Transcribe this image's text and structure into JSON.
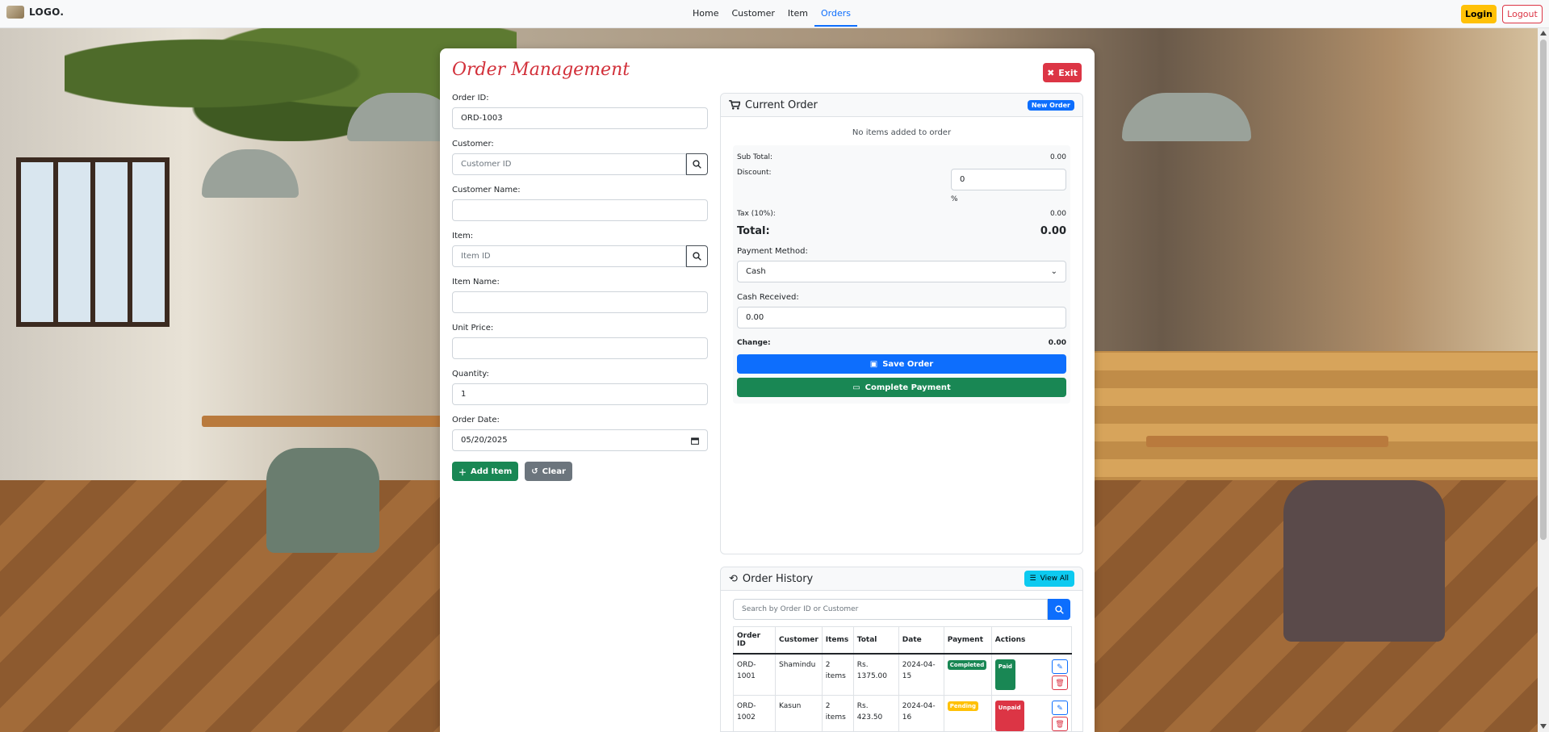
{
  "navbar": {
    "logo_text": "LOGO.",
    "links": [
      "Home",
      "Customer",
      "Item",
      "Orders"
    ],
    "active_link": "Orders",
    "login_label": "Login",
    "logout_label": "Logout"
  },
  "page": {
    "title": "Order Management",
    "exit_label": "Exit"
  },
  "form": {
    "order_id_label": "Order ID:",
    "order_id_value": "ORD-1003",
    "customer_label": "Customer:",
    "customer_placeholder": "Customer ID",
    "customer_name_label": "Customer Name:",
    "customer_name_value": "",
    "item_label": "Item:",
    "item_placeholder": "Item ID",
    "item_name_label": "Item Name:",
    "item_name_value": "",
    "unit_price_label": "Unit Price:",
    "unit_price_value": "",
    "quantity_label": "Quantity:",
    "quantity_value": "1",
    "order_date_label": "Order Date:",
    "order_date_value": "05/20/2025",
    "add_item_label": "Add Item",
    "clear_label": "Clear"
  },
  "current_order": {
    "title": "Current Order",
    "badge": "New Order",
    "empty_message": "No items added to order",
    "subtotal_label": "Sub Total:",
    "subtotal_value": "0.00",
    "discount_label": "Discount:",
    "discount_value": "0",
    "discount_unit": "%",
    "tax_label": "Tax (10%):",
    "tax_value": "0.00",
    "total_label": "Total:",
    "total_value": "0.00",
    "payment_method_label": "Payment Method:",
    "payment_method_value": "Cash",
    "cash_received_label": "Cash Received:",
    "cash_received_value": "0.00",
    "change_label": "Change:",
    "change_value": "0.00",
    "save_label": "Save Order",
    "complete_label": "Complete Payment"
  },
  "order_history": {
    "title": "Order History",
    "view_all_label": "View All",
    "search_placeholder": "Search by Order ID or Customer",
    "columns": [
      "Order ID",
      "Customer",
      "Items",
      "Total",
      "Date",
      "Payment",
      "Actions"
    ],
    "rows": [
      {
        "order_id": "ORD-1001",
        "customer": "Shamindu",
        "items": "2 items",
        "total": "Rs. 1375.00",
        "date": "2024-04-15",
        "status": "Completed",
        "payment": "Paid"
      },
      {
        "order_id": "ORD-1002",
        "customer": "Kasun",
        "items": "2 items",
        "total": "Rs. 423.50",
        "date": "2024-04-16",
        "status": "Pending",
        "payment": "Unpaid"
      }
    ]
  },
  "colors": {
    "primary": "#0d6efd",
    "success": "#198754",
    "danger": "#dc3545",
    "warning": "#ffc107",
    "info": "#0dcaf0",
    "title_red": "#d2303a"
  }
}
